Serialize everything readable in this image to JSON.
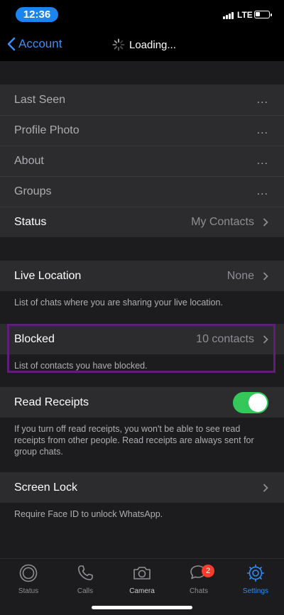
{
  "status_bar": {
    "time": "12:36",
    "network": "LTE"
  },
  "nav": {
    "back_label": "Account",
    "loading_text": "Loading..."
  },
  "privacy_group": [
    {
      "label": "Last Seen",
      "value": "..."
    },
    {
      "label": "Profile Photo",
      "value": "..."
    },
    {
      "label": "About",
      "value": "..."
    },
    {
      "label": "Groups",
      "value": "..."
    },
    {
      "label": "Status",
      "value": "My Contacts"
    }
  ],
  "live_location": {
    "label": "Live Location",
    "value": "None",
    "note": "List of chats where you are sharing your live location."
  },
  "blocked": {
    "label": "Blocked",
    "value": "10 contacts",
    "note": "List of contacts you have blocked."
  },
  "read_receipts": {
    "label": "Read Receipts",
    "enabled": true,
    "note": "If you turn off read receipts, you won't be able to see read receipts from other people. Read receipts are always sent for group chats."
  },
  "screen_lock": {
    "label": "Screen Lock",
    "note": "Require Face ID to unlock WhatsApp."
  },
  "tabs": [
    {
      "label": "Status",
      "icon": "status-icon"
    },
    {
      "label": "Calls",
      "icon": "phone-icon"
    },
    {
      "label": "Camera",
      "icon": "camera-icon"
    },
    {
      "label": "Chats",
      "icon": "chats-icon",
      "badge": "2"
    },
    {
      "label": "Settings",
      "icon": "settings-gear-icon",
      "active": true
    }
  ],
  "colors": {
    "accent": "#2f8df5",
    "toggle_on": "#34c759",
    "highlight": "#5e1e7a",
    "badge": "#ff3b30"
  }
}
